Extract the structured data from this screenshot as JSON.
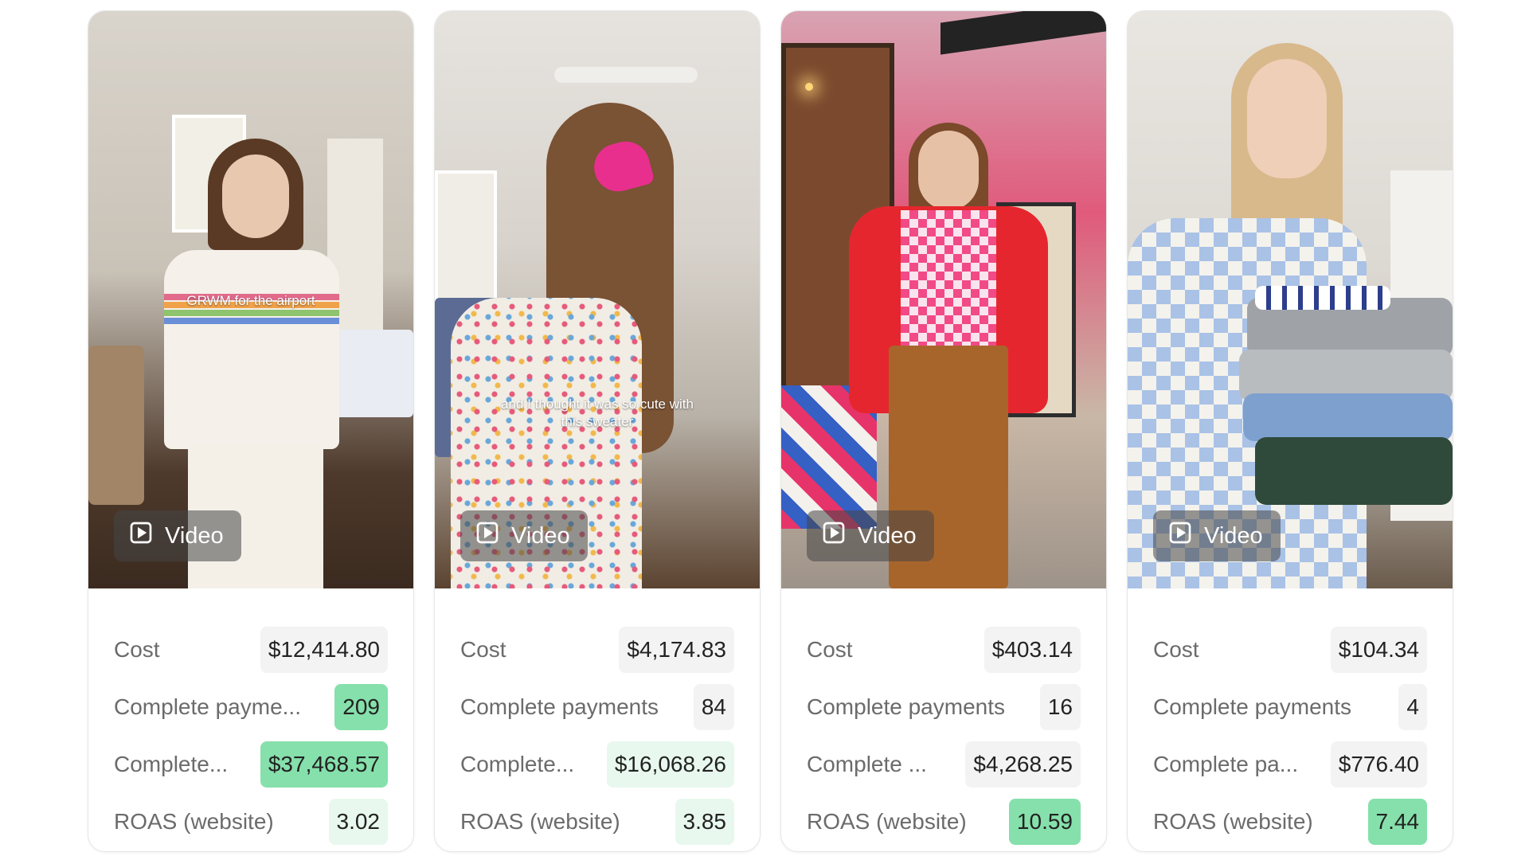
{
  "cards": [
    {
      "caption": "GRWM for the airport",
      "media_label": "Video",
      "media_icon": "play-square-icon",
      "metrics": [
        {
          "label": "Cost",
          "value": "$12,414.80"
        },
        {
          "label": "Complete payme...",
          "value": "209"
        },
        {
          "label": "Complete...",
          "value": "$37,468.57"
        },
        {
          "label": "ROAS (website)",
          "value": "3.02"
        }
      ]
    },
    {
      "caption": "and I thought it was so cute with this sweater",
      "media_label": "Video",
      "media_icon": "play-square-icon",
      "metrics": [
        {
          "label": "Cost",
          "value": "$4,174.83"
        },
        {
          "label": "Complete payments",
          "value": "84"
        },
        {
          "label": "Complete...",
          "value": "$16,068.26"
        },
        {
          "label": "ROAS (website)",
          "value": "3.85"
        }
      ]
    },
    {
      "caption": "",
      "media_label": "Video",
      "media_icon": "play-square-icon",
      "metrics": [
        {
          "label": "Cost",
          "value": "$403.14"
        },
        {
          "label": "Complete payments",
          "value": "16"
        },
        {
          "label": "Complete ...",
          "value": "$4,268.25"
        },
        {
          "label": "ROAS (website)",
          "value": "10.59"
        }
      ]
    },
    {
      "caption": "",
      "media_label": "Video",
      "media_icon": "play-square-icon",
      "metrics": [
        {
          "label": "Cost",
          "value": "$104.34"
        },
        {
          "label": "Complete payments",
          "value": "4"
        },
        {
          "label": "Complete pa...",
          "value": "$776.40"
        },
        {
          "label": "ROAS (website)",
          "value": "7.44"
        }
      ]
    }
  ],
  "colors": {
    "highlight_strong": "#86e0ab",
    "highlight_light": "#e8f8ee",
    "neutral_chip": "#f3f3f3",
    "label_text": "#6b6b6b"
  }
}
